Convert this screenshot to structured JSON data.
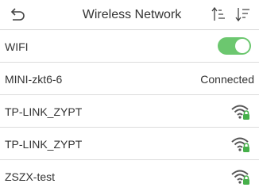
{
  "header": {
    "title": "Wireless Network",
    "back_icon": "back-arrow-icon",
    "sort_asc_icon": "sort-ascending-icon",
    "sort_desc_icon": "sort-descending-icon"
  },
  "wifi": {
    "label": "WIFI",
    "enabled": true,
    "toggle_color": "#6cc76f"
  },
  "networks": [
    {
      "ssid": "MINI-zkt6-6",
      "status": "Connected"
    },
    {
      "ssid": "TP-LINK_ZYPT",
      "icon": "wifi-locked-icon"
    },
    {
      "ssid": "TP-LINK_ZYPT",
      "icon": "wifi-locked-icon"
    },
    {
      "ssid": "ZSZX-test",
      "icon": "wifi-locked-icon"
    }
  ],
  "colors": {
    "accent_green": "#6cc76f",
    "lock_green": "#46b04a",
    "text": "#333333",
    "divider": "#dcdcdc"
  }
}
